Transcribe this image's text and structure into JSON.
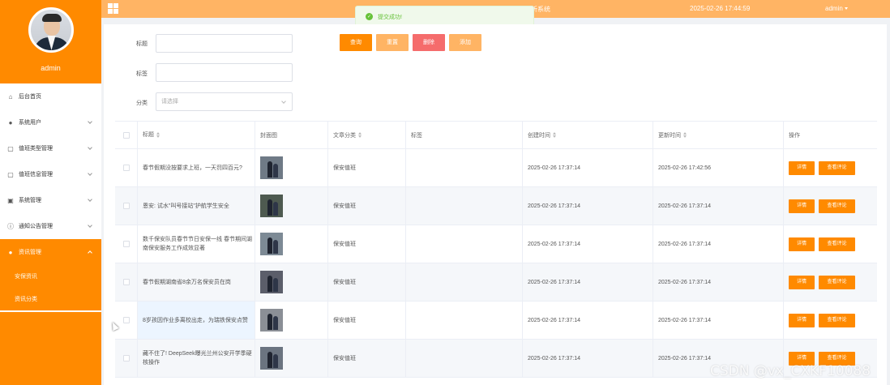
{
  "header": {
    "system_title_fragment": "析系统",
    "datetime": "2025-02-26 17:44:59",
    "user": "admin"
  },
  "toast": {
    "message": "提交成功!"
  },
  "sidebar": {
    "username": "admin",
    "menu": [
      {
        "label": "后台首页",
        "icon": "home-icon"
      },
      {
        "label": "系统用户",
        "icon": "user-icon"
      },
      {
        "label": "值班类型管理",
        "icon": "calendar-icon"
      },
      {
        "label": "值班信息管理",
        "icon": "calendar-icon"
      },
      {
        "label": "系统管理",
        "icon": "image-icon"
      },
      {
        "label": "通知公告管理",
        "icon": "info-icon"
      },
      {
        "label": "资讯管理",
        "icon": "bulb-icon"
      }
    ],
    "submenu": [
      {
        "label": "安保资讯"
      },
      {
        "label": "资讯分类"
      }
    ]
  },
  "filters": {
    "title_label": "标题",
    "tag_label": "标签",
    "category_label": "分类",
    "category_placeholder": "请选择",
    "buttons": {
      "search": "查询",
      "reset": "重置",
      "delete": "删除",
      "add": "添加"
    }
  },
  "table": {
    "columns": [
      "标题",
      "封面图",
      "文章分类",
      "标签",
      "创建时间",
      "更新时间",
      "操作"
    ],
    "ops": {
      "detail": "详情",
      "comments": "查看评论"
    },
    "rows": [
      {
        "title": "春节假期没按要求上班，一天罚四百元?",
        "category": "保安值班",
        "tag": "",
        "created": "2025-02-26 17:37:14",
        "updated": "2025-02-26 17:42:56"
      },
      {
        "title": "恩安: 试水\"叫号接站\"护航学生安全",
        "category": "保安值班",
        "tag": "",
        "created": "2025-02-26 17:37:14",
        "updated": "2025-02-26 17:37:14"
      },
      {
        "title": "数千保安队员春节节日安保一线 春节期间湖南保安服务工作成效显著",
        "category": "保安值班",
        "tag": "",
        "created": "2025-02-26 17:37:14",
        "updated": "2025-02-26 17:37:14"
      },
      {
        "title": "春节假期湖南省8余万名保安员在岗",
        "category": "保安值班",
        "tag": "",
        "created": "2025-02-26 17:37:14",
        "updated": "2025-02-26 17:37:14"
      },
      {
        "title": "8岁孩因作业多离校出走，为瑞铁保安点赞",
        "category": "保安值班",
        "tag": "",
        "created": "2025-02-26 17:37:14",
        "updated": "2025-02-26 17:37:14"
      },
      {
        "title": "藏不住了! DeepSeek曝光兰州公安开学季硬核操作",
        "category": "保安值班",
        "tag": "",
        "created": "2025-02-26 17:37:14",
        "updated": "2025-02-26 17:37:14"
      }
    ]
  },
  "watermark": "CSDN @vx_CXKF10088"
}
